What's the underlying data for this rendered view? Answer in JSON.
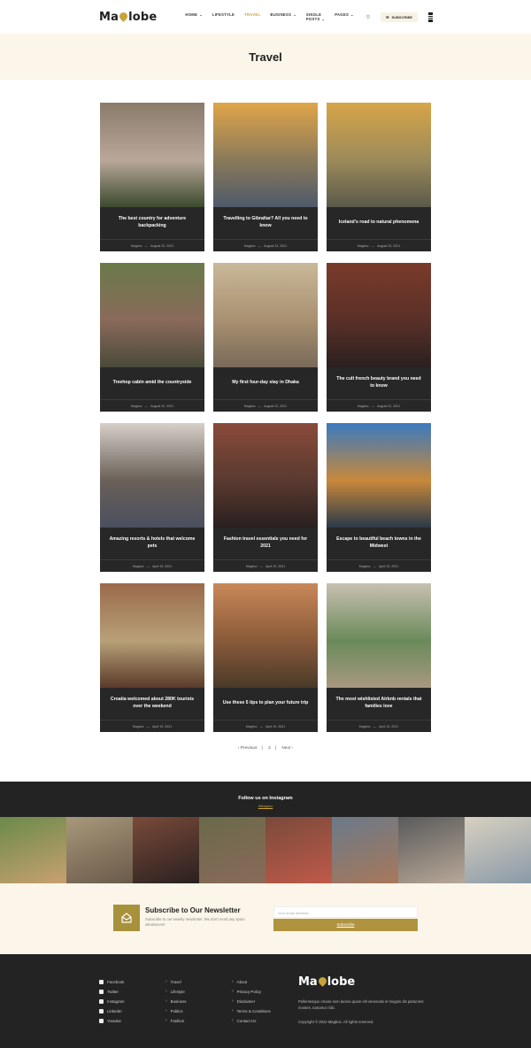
{
  "header": {
    "logo_left": "Ma",
    "logo_right": "lobe",
    "nav": [
      {
        "label": "HOME",
        "caret": true
      },
      {
        "label": "LIFESTYLE",
        "caret": false
      },
      {
        "label": "TRAVEL",
        "caret": false,
        "active": true
      },
      {
        "label": "BUSINESS",
        "caret": true
      },
      {
        "label": "SINGLE POSTS",
        "caret": true
      },
      {
        "label": "PAGES",
        "caret": true
      }
    ],
    "subscribe": "SUBSCRIBE"
  },
  "page_title": "Travel",
  "posts": [
    {
      "title": "The best country for adventure backpacking",
      "author": "Magbox",
      "date": "August 23, 2021",
      "colors": [
        "#8a7a6a",
        "#b9a89a",
        "#3c4a2e"
      ]
    },
    {
      "title": "Travelling to Gibraltar? All you need to know",
      "author": "Magbox",
      "date": "August 23, 2021",
      "colors": [
        "#e0a548",
        "#8a7a5a",
        "#4e5a6a"
      ]
    },
    {
      "title": "Iceland's road to natural phenomena",
      "author": "Magbox",
      "date": "August 23, 2021",
      "colors": [
        "#d6a548",
        "#9c8a5a",
        "#5a5a4a"
      ]
    },
    {
      "title": "Treehop cabin amid the countryside",
      "author": "Magbox",
      "date": "August 22, 2021",
      "colors": [
        "#6a7a4a",
        "#8a6a5a",
        "#4a4a3a"
      ]
    },
    {
      "title": "My first four-day stay in Dhaka",
      "author": "Magbox",
      "date": "August 22, 2021",
      "colors": [
        "#c9b899",
        "#a89070",
        "#7a6a5a"
      ]
    },
    {
      "title": "The cult french beauty brand you need to know",
      "author": "Magbox",
      "date": "August 22, 2021",
      "colors": [
        "#7a3a2a",
        "#5a3028",
        "#2a2020"
      ]
    },
    {
      "title": "Amazing resorts & hotels that welcome pets",
      "author": "Magbox",
      "date": "April 19, 2021",
      "colors": [
        "#d5d0c8",
        "#6a6058",
        "#4a5060"
      ]
    },
    {
      "title": "Fashion travel essentials you need for 2021",
      "author": "Magbox",
      "date": "April 19, 2021",
      "colors": [
        "#8a4a3a",
        "#5a3a30",
        "#2a2020"
      ]
    },
    {
      "title": "Escape to beautiful beach towns in the Midwest",
      "author": "Magbox",
      "date": "April 19, 2021",
      "colors": [
        "#3a7ac0",
        "#c8883a",
        "#2a3a4a"
      ]
    },
    {
      "title": "Croatia welcomed about 280K tourists over the weekend",
      "author": "Magbox",
      "date": "April 19, 2021",
      "colors": [
        "#9a6a4a",
        "#b8a078",
        "#5a3a2a"
      ]
    },
    {
      "title": "Use these 5 tips to plan your future trip",
      "author": "Magbox",
      "date": "April 19, 2021",
      "colors": [
        "#c88858",
        "#8a5a3a",
        "#4a3a2a"
      ]
    },
    {
      "title": "The most wishlisted Airbnb rentals that families love",
      "author": "Magbox",
      "date": "April 19, 2021",
      "colors": [
        "#c8c0b0",
        "#6a8a5a",
        "#a89880"
      ]
    }
  ],
  "pagination": {
    "prev": "‹ Previous",
    "page": "2",
    "next": "Next ›"
  },
  "instagram": {
    "title": "Follow us on Instagram",
    "handle": "#Magbox",
    "photos": [
      {
        "colors": [
          "#6a8a4a",
          "#c8a070"
        ]
      },
      {
        "colors": [
          "#a8987a",
          "#6a5a4a"
        ]
      },
      {
        "colors": [
          "#7a4a3a",
          "#2a2020"
        ]
      },
      {
        "colors": [
          "#6a6a4a",
          "#8a6a5a"
        ]
      },
      {
        "colors": [
          "#7a4a3a",
          "#c05a4a"
        ]
      },
      {
        "colors": [
          "#6a7a8a",
          "#a8785a"
        ]
      },
      {
        "colors": [
          "#5a5a5a",
          "#b8a898"
        ]
      },
      {
        "colors": [
          "#d8d0c0",
          "#8a9aa8"
        ]
      }
    ]
  },
  "newsletter": {
    "title": "Subscribe to Our Newsletter",
    "text": "Subscribe to our weekly newsletter. We don't send any spam whatsoever!",
    "placeholder": "Your email address...",
    "button": "Subscribe"
  },
  "footer": {
    "social": [
      "Facebook",
      "Twitter",
      "Instagram",
      "LinkedIn",
      "Youtube"
    ],
    "categories": [
      "Travel",
      "Lifestyle",
      "Business",
      "Politics",
      "Fashion"
    ],
    "pages": [
      "About",
      "Privacy Policy",
      "Disclaimer",
      "Terms & Conditions",
      "Contact Us"
    ],
    "logo_left": "Ma",
    "logo_right": "lobe",
    "description": "Pellentesque ornare sem lacinia quam elit venenatis et magnis dis parturient montes, nascetur ridic.",
    "copyright": "Copyright © 2022 Magbox. All rights reserved."
  }
}
